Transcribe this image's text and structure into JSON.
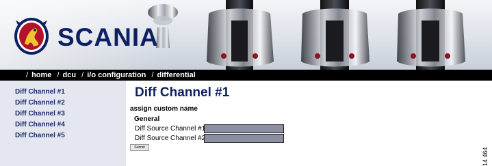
{
  "brand": {
    "name": "SCANIA",
    "accent_color": "#0e1f63"
  },
  "breadcrumb": [
    {
      "label": "home"
    },
    {
      "label": "dcu"
    },
    {
      "label": "i/o configuration"
    },
    {
      "label": "differential"
    }
  ],
  "sidebar": {
    "items": [
      {
        "label": "Diff Channel #1"
      },
      {
        "label": "Diff Channel #2"
      },
      {
        "label": "Diff Channel #3"
      },
      {
        "label": "Diff Channel #4"
      },
      {
        "label": "Diff Channel #5"
      }
    ]
  },
  "main": {
    "title": "Diff Channel #1",
    "subtitle": "assign custom name",
    "section": "General",
    "fields": [
      {
        "label": "Diff Source Channel #1:",
        "value": ""
      },
      {
        "label": "Diff Source Channel #2:",
        "value": ""
      }
    ],
    "submit_label": "Submit"
  },
  "figure_id": "14 464",
  "icons": [
    "scania-griffin-logo-icon",
    "breadcrumb-slash-icon"
  ]
}
